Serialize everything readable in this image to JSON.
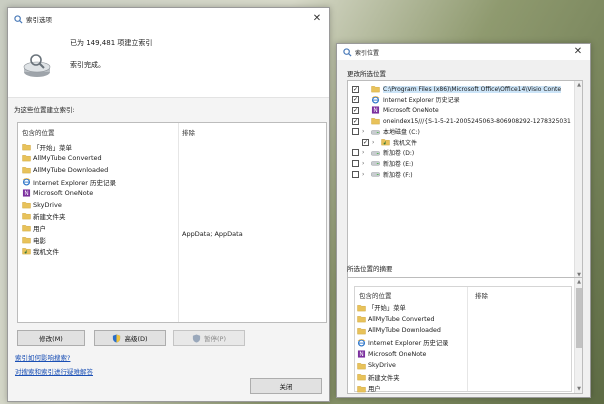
{
  "indexing_options": {
    "title": "索引选项",
    "status_count": "已为 149,481 项建立索引",
    "status_state": "索引完成。",
    "section_label": "为这些位置建立索引:",
    "columns": {
      "included": "包含的位置",
      "excluded": "排除"
    },
    "locations": [
      {
        "icon": "folder-icon",
        "label": "「开始」菜单"
      },
      {
        "icon": "folder-icon",
        "label": "AllMyTube Converted"
      },
      {
        "icon": "folder-icon",
        "label": "AllMyTube Downloaded"
      },
      {
        "icon": "ie-icon",
        "label": "Internet Explorer 历史记录"
      },
      {
        "icon": "onenote-icon",
        "label": "Microsoft OneNote"
      },
      {
        "icon": "folder-icon",
        "label": "SkyDrive"
      },
      {
        "icon": "folder-icon",
        "label": "新建文件夹"
      },
      {
        "icon": "folder-icon",
        "label": "用户"
      },
      {
        "icon": "folder-icon",
        "label": "电影"
      },
      {
        "icon": "folder-music-icon",
        "label": "我机文件"
      }
    ],
    "excluded_value": "AppData; AppData",
    "buttons": {
      "modify": "修改(M)",
      "advanced": "高级(D)",
      "pause": "暂停(P)",
      "close": "关闭"
    },
    "links": {
      "how_affects": "索引如何影响搜索?",
      "troubleshoot": "对搜索和索引进行疑难解答"
    }
  },
  "indexed_locations": {
    "title": "索引位置",
    "change_label": "更改所选位置",
    "tree": [
      {
        "checked": true,
        "arrow": "",
        "indent": 0,
        "icon": "folder-icon",
        "label": "C:\\Program Files (x86)\\Microsoft Office\\Office14\\Visio Conte",
        "selected": true
      },
      {
        "checked": true,
        "arrow": "",
        "indent": 0,
        "icon": "ie-icon",
        "label": "Internet Explorer 历史记录",
        "selected": false
      },
      {
        "checked": true,
        "arrow": "",
        "indent": 0,
        "icon": "onenote-icon",
        "label": "Microsoft OneNote",
        "selected": false
      },
      {
        "checked": true,
        "arrow": "",
        "indent": 0,
        "icon": "folder-icon",
        "label": "oneindex15///{S-1-5-21-2005245063-806908292-1278325031",
        "selected": false
      },
      {
        "checked": false,
        "arrow": "›",
        "indent": 0,
        "icon": "drive-icon",
        "label": "本地磁盘 (C:)",
        "selected": false
      },
      {
        "checked": true,
        "arrow": "›",
        "indent": 1,
        "icon": "folder-music-icon",
        "label": "我机文件",
        "selected": false
      },
      {
        "checked": false,
        "arrow": "›",
        "indent": 0,
        "icon": "drive-icon",
        "label": "新加卷 (D:)",
        "selected": false
      },
      {
        "checked": false,
        "arrow": "›",
        "indent": 0,
        "icon": "drive-icon",
        "label": "新加卷 (E:)",
        "selected": false
      },
      {
        "checked": false,
        "arrow": "›",
        "indent": 0,
        "icon": "drive-icon",
        "label": "新加卷 (F:)",
        "selected": false
      }
    ],
    "summary_label": "所选位置的摘要",
    "summary_columns": {
      "included": "包含的位置",
      "excluded": "排除"
    },
    "summary": [
      {
        "icon": "folder-icon",
        "label": "「开始」菜单"
      },
      {
        "icon": "folder-icon",
        "label": "AllMyTube Converted"
      },
      {
        "icon": "folder-icon",
        "label": "AllMyTube Downloaded"
      },
      {
        "icon": "ie-icon",
        "label": "Internet Explorer 历史记录"
      },
      {
        "icon": "onenote-icon",
        "label": "Microsoft OneNote"
      },
      {
        "icon": "folder-icon",
        "label": "SkyDrive"
      },
      {
        "icon": "folder-icon",
        "label": "新建文件夹"
      },
      {
        "icon": "folder-icon",
        "label": "用户"
      }
    ]
  },
  "colors": {
    "folder": "#e8c25a",
    "selection": "#cce4f7",
    "link": "#1a4fb5",
    "onenote": "#7b2f9e",
    "ie": "#2a73c8"
  }
}
